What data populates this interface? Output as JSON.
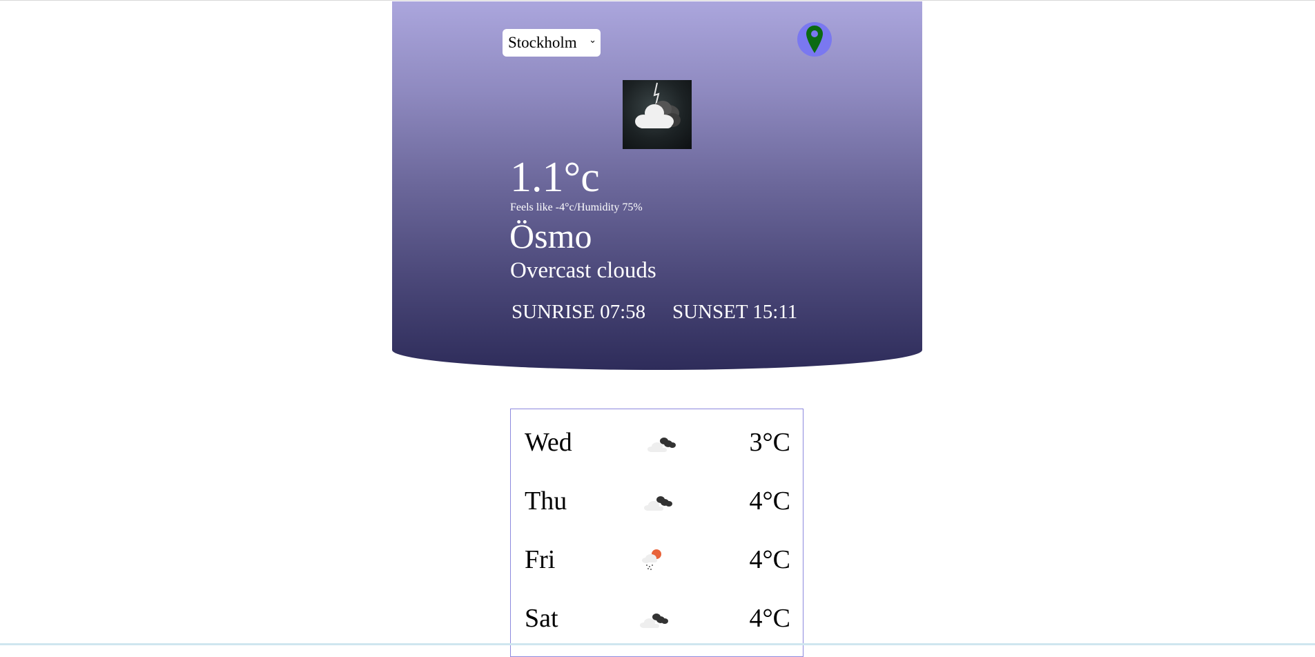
{
  "header": {
    "city_select": {
      "selected": "Stockholm",
      "chevron_icon": "chevron-down-icon"
    },
    "location_button": {
      "icon": "map-pin-icon",
      "bg_color": "#7a78f0",
      "pin_color": "#0b6a12"
    }
  },
  "current": {
    "weather_image": "thunder-cloud-icon",
    "temperature": "1.1°c",
    "details": "Feels like -4°c/Humidity 75%",
    "location": "Ösmo",
    "description": "Overcast clouds",
    "sunrise": "SUNRISE 07:58",
    "sunset": "SUNSET 15:11"
  },
  "forecast": {
    "days": [
      {
        "day": "Wed",
        "icon": "broken-clouds-icon",
        "temp": "3°C"
      },
      {
        "day": "Thu",
        "icon": "broken-clouds-icon",
        "temp": "4°C"
      },
      {
        "day": "Fri",
        "icon": "sun-rain-icon",
        "temp": "4°C"
      },
      {
        "day": "Sat",
        "icon": "broken-clouds-icon",
        "temp": "4°C"
      }
    ]
  },
  "colors": {
    "gradient_top": "#aba6dd",
    "gradient_bottom": "#2e2c5a",
    "forecast_border": "#8c88dd"
  }
}
